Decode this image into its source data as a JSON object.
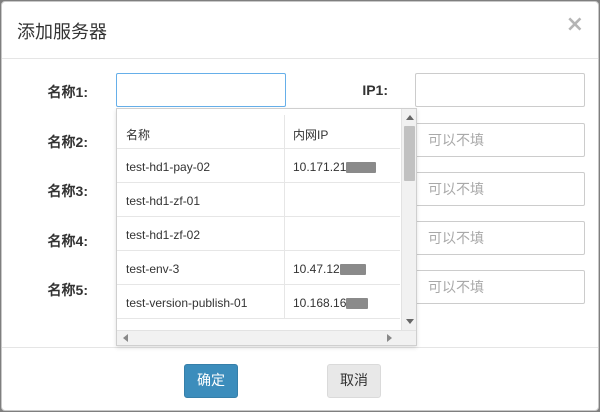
{
  "dialog": {
    "title": "添加服务器",
    "close_glyph": "×"
  },
  "form": {
    "rows": [
      {
        "label": "名称1:",
        "name_value": "",
        "ip_value": "",
        "ip_placeholder": ""
      },
      {
        "label": "名称2:",
        "ip_placeholder": "可以不填"
      },
      {
        "label": "名称3:",
        "ip_placeholder": "可以不填"
      },
      {
        "label": "名称4:",
        "ip_placeholder": "可以不填"
      },
      {
        "label": "名称5:",
        "ip_placeholder": "可以不填"
      }
    ],
    "ip_label": "IP1:"
  },
  "dropdown": {
    "headers": {
      "name": "名称",
      "ip": "内网IP"
    },
    "rows": [
      {
        "name": "test-hd1-pay-02",
        "ip": "10.171.21",
        "ip_redacted": true
      },
      {
        "name": "test-hd1-zf-01",
        "ip": "",
        "ip_redacted": false
      },
      {
        "name": "test-hd1-zf-02",
        "ip": "",
        "ip_redacted": false
      },
      {
        "name": "test-env-3",
        "ip": "10.47.12",
        "ip_redacted": true
      },
      {
        "name": "test-version-publish-01",
        "ip": "10.168.16",
        "ip_redacted": true
      }
    ]
  },
  "footer": {
    "confirm_label": "确定",
    "cancel_label": "取消"
  },
  "colors": {
    "primary": "#3c8dbc",
    "focus_border": "#66afe9"
  }
}
